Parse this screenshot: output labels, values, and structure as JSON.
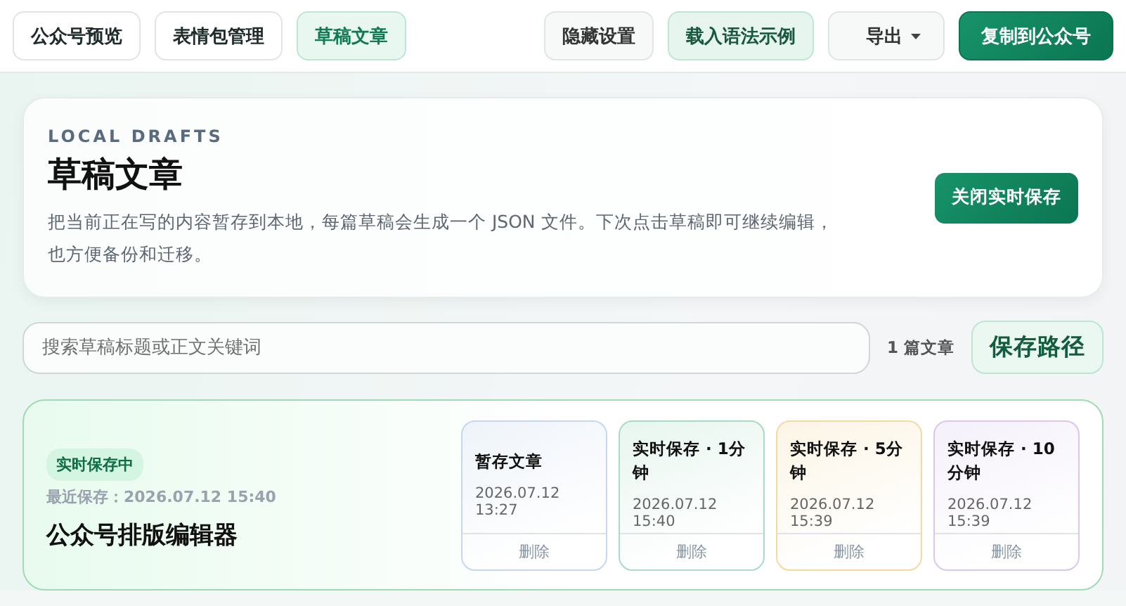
{
  "tabs": [
    {
      "label": "公众号预览",
      "selected": false
    },
    {
      "label": "表情包管理",
      "selected": false
    },
    {
      "label": "草稿文章",
      "selected": true
    }
  ],
  "actions": [
    {
      "label": "隐藏设置",
      "kind": "plain"
    },
    {
      "label": "载入语法示例",
      "kind": "soft"
    },
    {
      "label": "导出",
      "kind": "dropdown"
    },
    {
      "label": "复制到公众号",
      "kind": "primary"
    }
  ],
  "hero": {
    "eyebrow": "LOCAL DRAFTS",
    "title": "草稿文章",
    "description": "把当前正在写的内容暂存到本地，每篇草稿会生成一个 JSON 文件。下次点击草稿即可继续编辑，也方便备份和迁移。",
    "button": "关闭实时保存"
  },
  "search": {
    "placeholder": "搜索草稿标题或正文关键词",
    "count": "1 篇文章",
    "path_button": "保存路径"
  },
  "draft": {
    "status": "实时保存中",
    "last_saved_label": "最近保存：",
    "last_saved": "2026.07.12 15:40",
    "title": "公众号排版编辑器",
    "versions": [
      {
        "title": "暂存文章",
        "time": "2026.07.12 13:27",
        "action": "删除",
        "color": "#c7d7f0"
      },
      {
        "title": "实时保存 · 1分钟",
        "time": "2026.07.12 15:40",
        "action": "删除",
        "color": "#a9dcc4"
      },
      {
        "title": "实时保存 · 5分钟",
        "time": "2026.07.12 15:39",
        "action": "删除",
        "color": "#f5d9a0"
      },
      {
        "title": "实时保存 · 10分钟",
        "time": "2026.07.12 15:39",
        "action": "删除",
        "color": "#d9c8ee"
      }
    ]
  }
}
